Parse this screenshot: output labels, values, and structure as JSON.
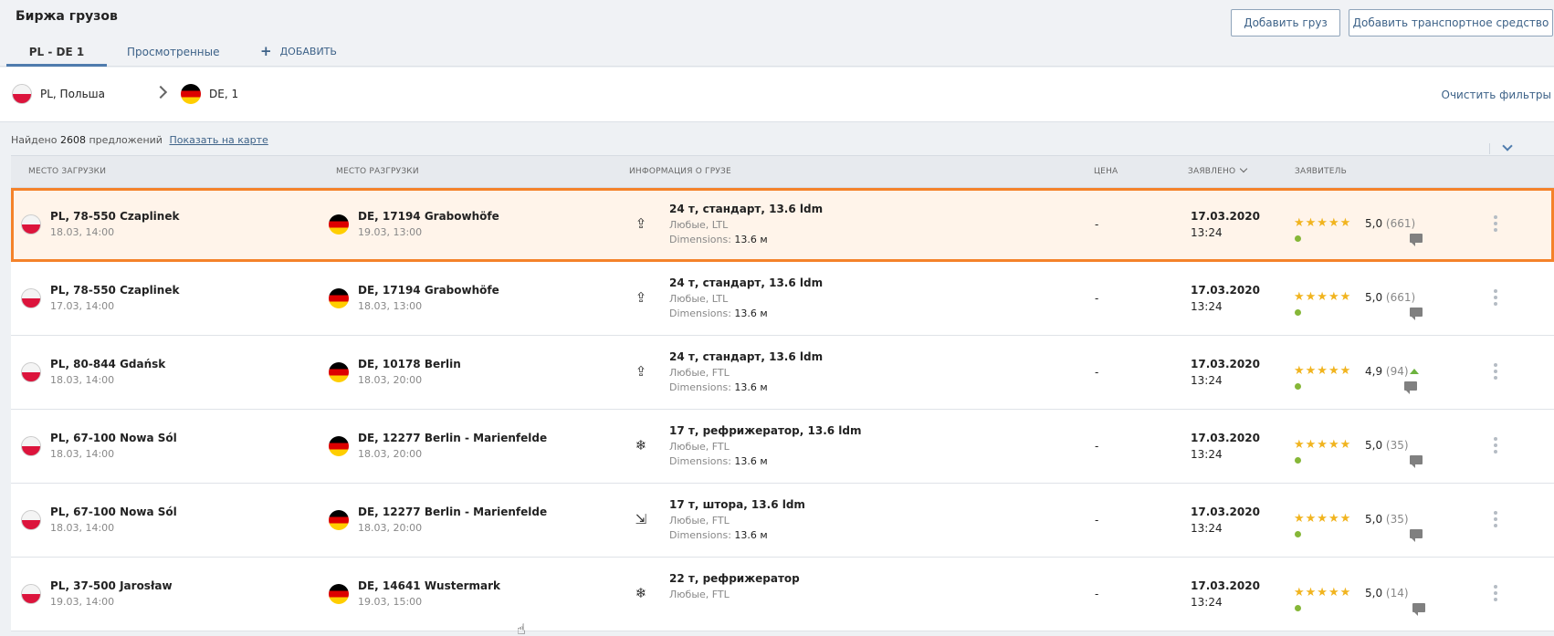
{
  "app_title": "Биржа грузов",
  "header_buttons": {
    "add_cargo": "Добавить груз",
    "add_vehicle": "Добавить транспортное средство"
  },
  "tabs": [
    {
      "label": "PL - DE 1",
      "active": true
    },
    {
      "label": "Просмотренные",
      "active": false
    },
    {
      "label": "ДОБАВИТЬ",
      "icon": "plus-icon",
      "active": false
    }
  ],
  "filter": {
    "from": "PL, Польша",
    "to": "DE, 1",
    "clear": "Очистить фильтры"
  },
  "results": {
    "prefix": "Найдено",
    "count": "2608",
    "suffix": "предложений",
    "map_link": "Показать на карте"
  },
  "columns": {
    "loading": "МЕСТО ЗАГРУЗКИ",
    "unloading": "МЕСТО РАЗГРУЗКИ",
    "cargo": "ИНФОРМАЦИЯ О ГРУЗЕ",
    "price": "ЦЕНА",
    "posted": "ЗАЯВЛЕНО",
    "applicant": "ЗАЯВИТЕЛЬ"
  },
  "colors": {
    "accent": "#3d6288",
    "selection": "#f4822a",
    "star": "#f1b41f",
    "online": "#86b738"
  },
  "rows": [
    {
      "from": "PL, 78-550 Czaplinek",
      "from_date": "18.03, 14:00",
      "to": "DE, 17194 Grabowhöfe",
      "to_date": "19.03, 13:00",
      "cargo_icon": "upload-icon",
      "cargo": "24 т, стандарт, 13.6 ldm",
      "cargo_sub": "Любые, LTL",
      "dim_label": "Dimensions:",
      "dim_value": "13.6 м",
      "price": "-",
      "date": "17.03.2020",
      "time": "13:24",
      "stars": "★★★★★",
      "rating": "5,0",
      "rating_count": "(661)",
      "selected": true
    },
    {
      "from": "PL, 78-550 Czaplinek",
      "from_date": "17.03, 14:00",
      "to": "DE, 17194 Grabowhöfe",
      "to_date": "18.03, 13:00",
      "cargo_icon": "upload-icon",
      "cargo": "24 т, стандарт, 13.6 ldm",
      "cargo_sub": "Любые, LTL",
      "dim_label": "Dimensions:",
      "dim_value": "13.6 м",
      "price": "-",
      "date": "17.03.2020",
      "time": "13:24",
      "stars": "★★★★★",
      "rating": "5,0",
      "rating_count": "(661)"
    },
    {
      "from": "PL, 80-844 Gdańsk",
      "from_date": "18.03, 14:00",
      "to": "DE, 10178 Berlin",
      "to_date": "18.03, 20:00",
      "cargo_icon": "upload-icon",
      "cargo": "24 т, стандарт, 13.6 ldm",
      "cargo_sub": "Любые, FTL",
      "dim_label": "Dimensions:",
      "dim_value": "13.6 м",
      "price": "-",
      "date": "17.03.2020",
      "time": "13:24",
      "stars": "★★★★★",
      "rating": "4,9",
      "rating_count": "(94)",
      "trend": true
    },
    {
      "from": "PL, 67-100 Nowa Sól",
      "from_date": "18.03, 14:00",
      "to": "DE, 12277 Berlin - Marienfelde",
      "to_date": "18.03, 20:00",
      "cargo_icon": "snowflake-icon",
      "cargo": "17 т, рефрижератор, 13.6 ldm",
      "cargo_sub": "Любые, FTL",
      "dim_label": "Dimensions:",
      "dim_value": "13.6 м",
      "price": "-",
      "date": "17.03.2020",
      "time": "13:24",
      "stars": "★★★★★",
      "rating": "5,0",
      "rating_count": "(35)"
    },
    {
      "from": "PL, 67-100 Nowa Sól",
      "from_date": "18.03, 14:00",
      "to": "DE, 12277 Berlin - Marienfelde",
      "to_date": "18.03, 20:00",
      "cargo_icon": "curtain-icon",
      "cargo": "17 т, штора, 13.6 ldm",
      "cargo_sub": "Любые, FTL",
      "dim_label": "Dimensions:",
      "dim_value": "13.6 м",
      "price": "-",
      "date": "17.03.2020",
      "time": "13:24",
      "stars": "★★★★★",
      "rating": "5,0",
      "rating_count": "(35)"
    },
    {
      "from": "PL, 37-500 Jarosław",
      "from_date": "19.03, 14:00",
      "to": "DE, 14641 Wustermark",
      "to_date": "19.03, 15:00",
      "cargo_icon": "snowflake-icon",
      "cargo": "22 т, рефрижератор",
      "cargo_sub": "Любые, FTL",
      "price": "-",
      "date": "17.03.2020",
      "time": "13:24",
      "stars": "★★★★★",
      "rating": "5,0",
      "rating_count": "(14)"
    }
  ]
}
